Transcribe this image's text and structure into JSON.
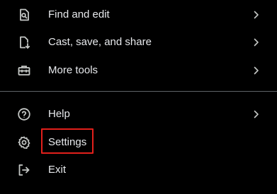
{
  "menu": {
    "items": [
      {
        "label": "Find and edit",
        "icon": "find-in-page-icon",
        "has_submenu": true
      },
      {
        "label": "Cast, save, and share",
        "icon": "file-save-icon",
        "has_submenu": true
      },
      {
        "label": "More tools",
        "icon": "toolbox-icon",
        "has_submenu": true
      },
      {
        "label": "Help",
        "icon": "help-circle-icon",
        "has_submenu": true
      },
      {
        "label": "Settings",
        "icon": "gear-icon",
        "has_submenu": false,
        "highlighted": true
      },
      {
        "label": "Exit",
        "icon": "exit-icon",
        "has_submenu": false
      }
    ]
  },
  "colors": {
    "background": "#000000",
    "text": "#e8eaed",
    "icon": "#c4c7c5",
    "divider": "#5f6368",
    "highlight_border": "#e3201b"
  }
}
